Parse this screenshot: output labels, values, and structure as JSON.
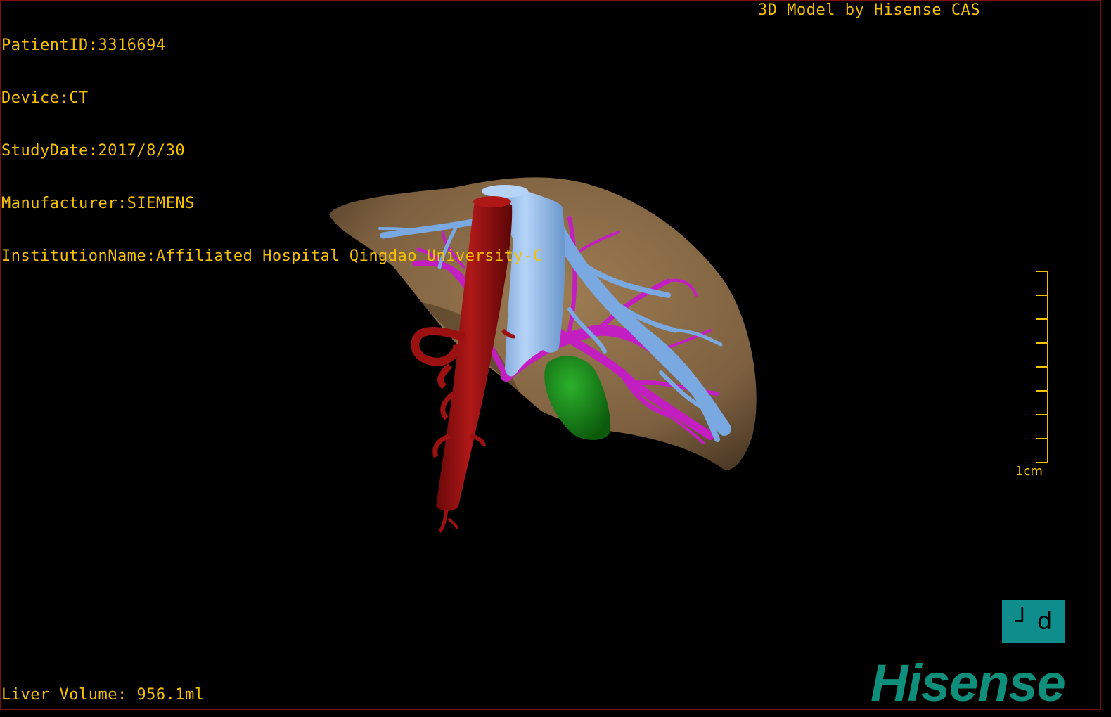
{
  "header": {
    "lines": [
      "PatientID:3316694",
      "Device:CT",
      "StudyDate:2017/8/30",
      "Manufacturer:SIEMENS",
      "InstitutionName:Affiliated Hospital Qingdao University-C"
    ],
    "credit": "3D Model by Hisense CAS"
  },
  "footer": {
    "volume": "Liver Volume: 956.1ml"
  },
  "scale_bar": {
    "label": "1cm"
  },
  "orientation": {
    "glyph": "┘ d"
  },
  "brand": {
    "logo_text": "Hisense"
  },
  "colors": {
    "overlay_text": "#f5c000",
    "liver": "#8a6b46",
    "artery": "#9b1010",
    "portal_vein": "#c21ec2",
    "hepatic_vein": "#7aa8e0",
    "gallbladder": "#1a8c1a",
    "logo": "#0e8f7c",
    "orientation_cube": "#0f8c8c"
  }
}
